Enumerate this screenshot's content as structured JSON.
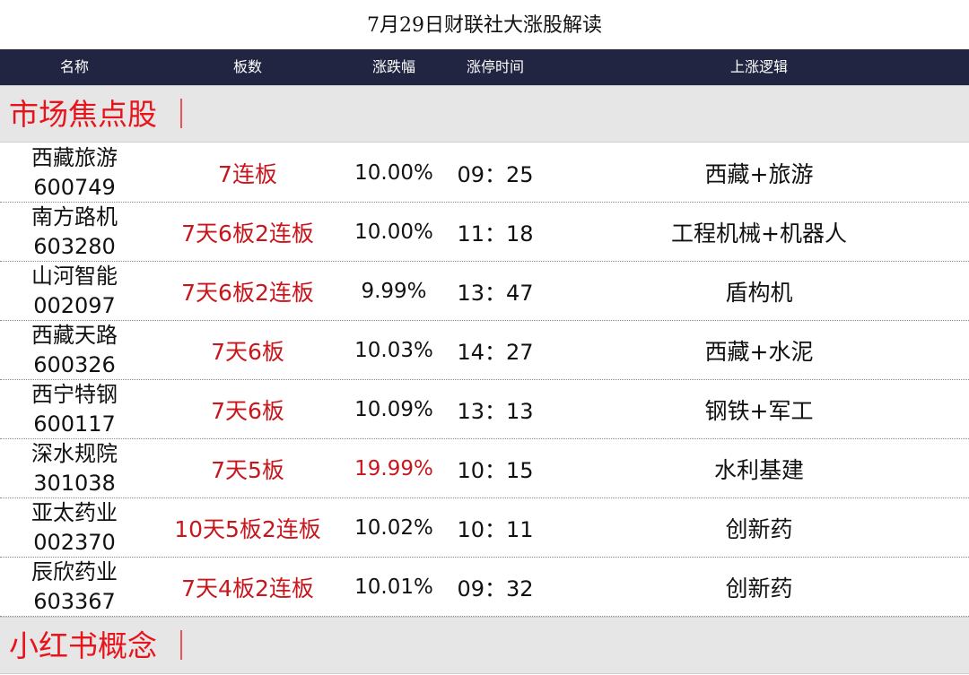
{
  "title": "7月29日财联社大涨股解读",
  "columns": [
    "名称",
    "板数",
    "涨跌幅",
    "涨停时间",
    "上涨逻辑"
  ],
  "sections": [
    {
      "label": "市场焦点股 ｜"
    },
    {
      "label": "小红书概念 ｜"
    }
  ],
  "rows": [
    {
      "name": "西藏旅游",
      "code": "600749",
      "board": "7连板",
      "pct": "10.00%",
      "time": "09：25",
      "logic": "西藏+旅游"
    },
    {
      "name": "南方路机",
      "code": "603280",
      "board": "7天6板2连板",
      "pct": "10.00%",
      "time": "11：18",
      "logic": "工程机械+机器人"
    },
    {
      "name": "山河智能",
      "code": "002097",
      "board": "7天6板2连板",
      "pct": "9.99%",
      "time": "13：47",
      "logic": "盾构机"
    },
    {
      "name": "西藏天路",
      "code": "600326",
      "board": "7天6板",
      "pct": "10.03%",
      "time": "14：27",
      "logic": "西藏+水泥"
    },
    {
      "name": "西宁特钢",
      "code": "600117",
      "board": "7天6板",
      "pct": "10.09%",
      "time": "13：13",
      "logic": "钢铁+军工"
    },
    {
      "name": "深水规院",
      "code": "301038",
      "board": "7天5板",
      "pct": "19.99%",
      "time": "10：15",
      "logic": "水利基建"
    },
    {
      "name": "亚太药业",
      "code": "002370",
      "board": "10天5板2连板",
      "pct": "10.02%",
      "time": "10：11",
      "logic": "创新药"
    },
    {
      "name": "辰欣药业",
      "code": "603367",
      "board": "7天4板2连板",
      "pct": "10.01%",
      "time": "09：32",
      "logic": "创新药"
    }
  ],
  "colors": {
    "header_bg": "#222542",
    "accent_red": "#c8161d",
    "section_bg": "#e6e6e6"
  }
}
